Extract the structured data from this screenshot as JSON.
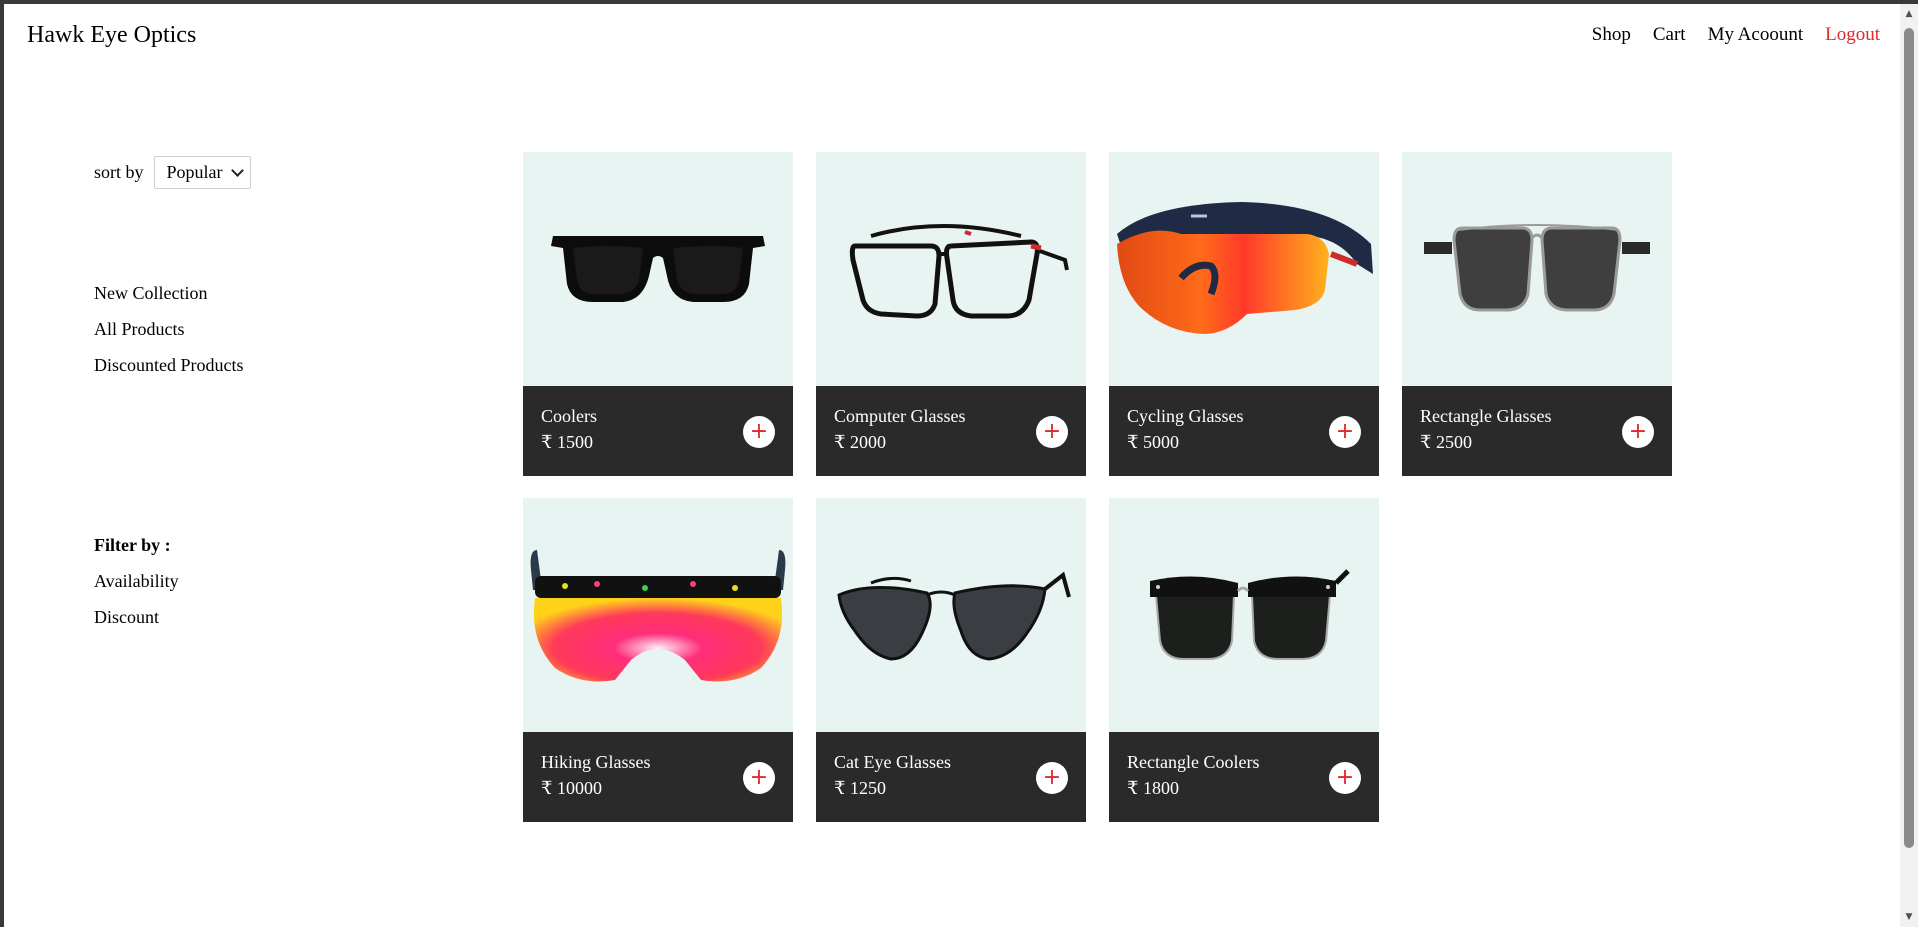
{
  "header": {
    "brand": "Hawk Eye Optics",
    "nav": [
      "Shop",
      "Cart",
      "My Acoount",
      "Logout"
    ]
  },
  "sidebar": {
    "sort_label": "sort by",
    "sort_value": "Popular",
    "collections": [
      "New Collection",
      "All Products",
      "Discounted Products"
    ],
    "filter_title": "Filter by :",
    "filters": [
      "Availability",
      "Discount"
    ]
  },
  "products": [
    {
      "name": "Coolers",
      "price": "₹ 1500",
      "icon": "sunglasses-black"
    },
    {
      "name": "Computer Glasses",
      "price": "₹ 2000",
      "icon": "clear-frame-glasses"
    },
    {
      "name": "Cycling Glasses",
      "price": "₹ 5000",
      "icon": "orange-shield-glasses"
    },
    {
      "name": "Rectangle Glasses",
      "price": "₹ 2500",
      "icon": "rectangle-grey-glasses"
    },
    {
      "name": "Hiking Glasses",
      "price": "₹ 10000",
      "icon": "pink-shield-glasses"
    },
    {
      "name": "Cat Eye Glasses",
      "price": "₹ 1250",
      "icon": "cat-eye-glasses"
    },
    {
      "name": "Rectangle Coolers",
      "price": "₹ 1800",
      "icon": "browline-sunglasses"
    }
  ],
  "add_button_symbol": "+",
  "colors": {
    "accent": "#e0282e",
    "card_bg": "#e8f4f2",
    "card_info_bg": "#2a2a2a"
  }
}
